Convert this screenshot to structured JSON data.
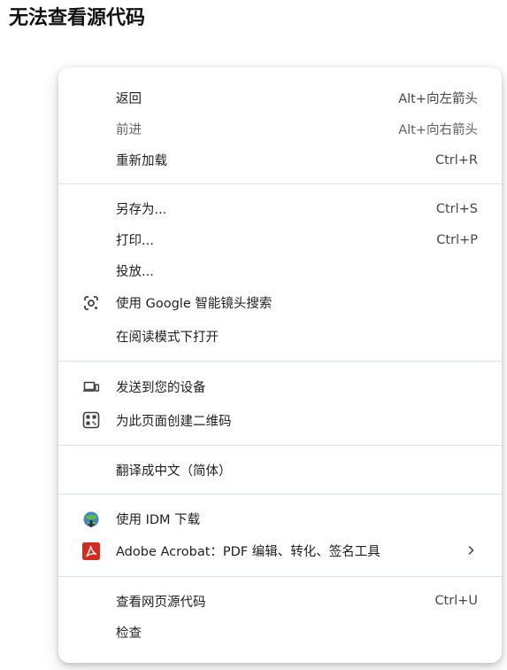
{
  "page": {
    "title": "无法查看源代码"
  },
  "menu": {
    "back": {
      "label": "返回",
      "shortcut": "Alt+向左箭头"
    },
    "forward": {
      "label": "前进",
      "shortcut": "Alt+向右箭头"
    },
    "reload": {
      "label": "重新加载",
      "shortcut": "Ctrl+R"
    },
    "save_as": {
      "label": "另存为...",
      "shortcut": "Ctrl+S"
    },
    "print": {
      "label": "打印...",
      "shortcut": "Ctrl+P"
    },
    "cast": {
      "label": "投放..."
    },
    "google_lens": {
      "label": "使用 Google 智能镜头搜索",
      "icon": "lens-icon"
    },
    "reading_mode": {
      "label": "在阅读模式下打开"
    },
    "send_to_devices": {
      "label": "发送到您的设备",
      "icon": "devices-icon"
    },
    "qr_code": {
      "label": "为此页面创建二维码",
      "icon": "qr-code-icon"
    },
    "translate": {
      "label": "翻译成中文（简体）"
    },
    "idm_download": {
      "label": "使用 IDM 下载",
      "icon": "idm-icon"
    },
    "acrobat": {
      "label": "Adobe Acrobat：PDF 编辑、转化、签名工具",
      "icon": "acrobat-icon"
    },
    "view_source": {
      "label": "查看网页源代码",
      "shortcut": "Ctrl+U"
    },
    "inspect": {
      "label": "检查"
    }
  },
  "colors": {
    "separator": "#d3e3ed",
    "acrobat_red": "#d52b1e",
    "text": "#1f1f1f",
    "disabled_text": "#5f6368"
  }
}
